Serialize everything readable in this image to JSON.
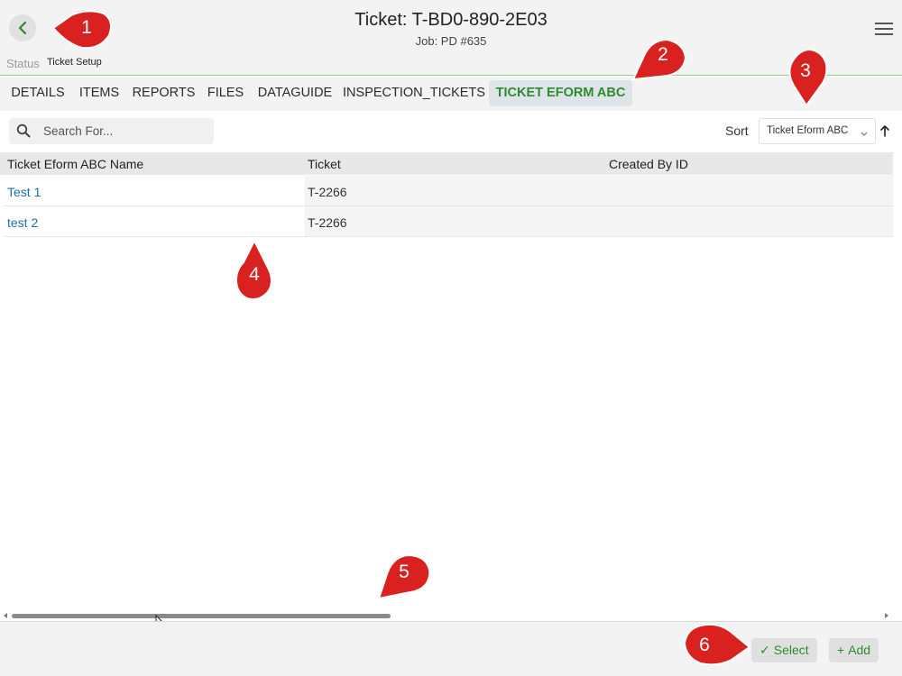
{
  "header": {
    "title": "Ticket: T-BD0-890-2E03",
    "subtitle": "Job: PD #635",
    "status_label": "Status",
    "status_value": "Ticket Setup"
  },
  "tabs": [
    {
      "label": "DETAILS",
      "active": false
    },
    {
      "label": "ITEMS",
      "active": false
    },
    {
      "label": "REPORTS",
      "active": false
    },
    {
      "label": "FILES",
      "active": false
    },
    {
      "label": "DATAGUIDE",
      "active": false
    },
    {
      "label": "INSPECTION_TICKETS",
      "active": false
    },
    {
      "label": "TICKET EFORM ABC",
      "active": true
    }
  ],
  "search": {
    "placeholder": "Search For...",
    "value": ""
  },
  "sort": {
    "label": "Sort",
    "selected": "Ticket Eform ABC",
    "direction": "ascending"
  },
  "table": {
    "columns": [
      "Ticket Eform ABC Name",
      "Ticket",
      "Created By ID"
    ],
    "rows": [
      {
        "name": "Test 1",
        "ticket": "T-2266",
        "created_by": ""
      },
      {
        "name": "test 2",
        "ticket": "T-2266",
        "created_by": ""
      }
    ]
  },
  "footer": {
    "select_label": "Select",
    "add_label": "Add"
  },
  "callouts": [
    "1",
    "2",
    "3",
    "4",
    "5",
    "6"
  ],
  "colors": {
    "accent_green": "#2e8b2e",
    "link_blue": "#1e6fa8",
    "callout_red": "#d9211f",
    "header_bg": "#f3f3f3"
  }
}
